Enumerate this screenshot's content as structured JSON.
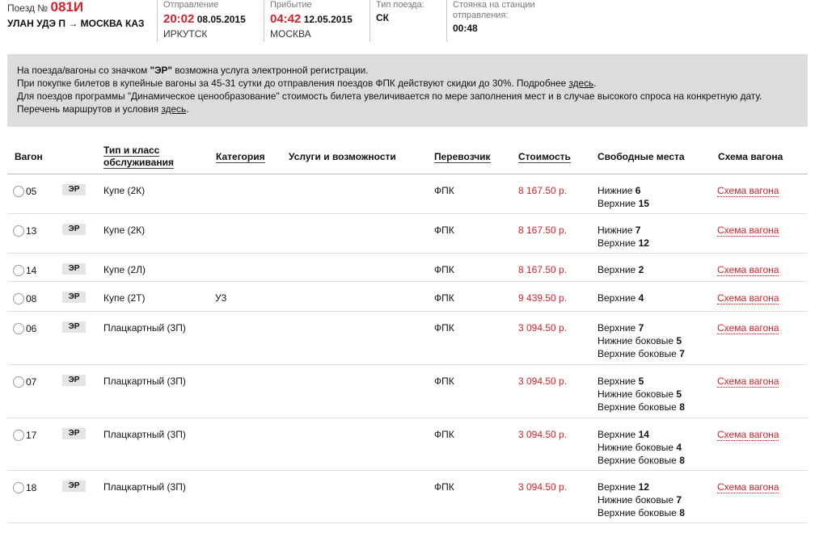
{
  "train": {
    "label": "Поезд №",
    "number": "081И",
    "route": "УЛАН УДЭ П → МОСКВА КАЗ"
  },
  "departure": {
    "label": "Отправление",
    "time": "20:02",
    "date": "08.05.2015",
    "city": "ИРКУТСК"
  },
  "arrival": {
    "label": "Прибытие",
    "time": "04:42",
    "date": "12.05.2015",
    "city": "МОСКВА"
  },
  "train_type": {
    "label": "Тип поезда:",
    "value": "СК"
  },
  "stop": {
    "label": "Стоянка на станции отправления:",
    "value": "00:48"
  },
  "info": {
    "line1_pre": "На поезда/вагоны со значком ",
    "line1_bold": "\"ЭР\"",
    "line1_post": " возможна услуга электронной регистрации.",
    "line2_pre": "При покупке билетов в купейные вагоны за 45-31 сутки до отправления поездов ФПК действуют скидки до 30%. Подробнее ",
    "line2_link": "здесь",
    "line2_post": ".",
    "line3": "Для поездов программы \"Динамическое ценообразование\" стоимость билета увеличивается по мере заполнения мест и в случае высокого спроса на конкретную дату.",
    "line4_pre": "Перечень маршрутов и условия ",
    "line4_link": "здесь",
    "line4_post": "."
  },
  "columns": {
    "car": "Вагон",
    "type_line1": "Тип и класс",
    "type_line2": "обслуживания",
    "category": "Категория",
    "services": "Услуги и возможности",
    "carrier": "Перевозчик",
    "price": "Стоимость",
    "seats": "Свободные места",
    "scheme": "Схема вагона"
  },
  "rows": [
    {
      "car": "05",
      "er": "ЭР",
      "type": "Купе (2К)",
      "category": "",
      "carrier": "ФПК",
      "price": "8 167.50 р.",
      "seats": [
        {
          "label": "Нижние",
          "count": "6"
        },
        {
          "label": "Верхние",
          "count": "15"
        }
      ],
      "scheme": "Схема вагона"
    },
    {
      "car": "13",
      "er": "ЭР",
      "type": "Купе (2К)",
      "category": "",
      "carrier": "ФПК",
      "price": "8 167.50 р.",
      "seats": [
        {
          "label": "Нижние",
          "count": "7"
        },
        {
          "label": "Верхние",
          "count": "12"
        }
      ],
      "scheme": "Схема вагона"
    },
    {
      "car": "14",
      "er": "ЭР",
      "type": "Купе (2Л)",
      "category": "",
      "carrier": "ФПК",
      "price": "8 167.50 р.",
      "seats": [
        {
          "label": "Верхние",
          "count": "2"
        }
      ],
      "scheme": "Схема вагона"
    },
    {
      "car": "08",
      "er": "ЭР",
      "type": "Купе (2Т)",
      "category": "У3",
      "carrier": "ФПК",
      "price": "9 439.50 р.",
      "seats": [
        {
          "label": "Верхние",
          "count": "4"
        }
      ],
      "scheme": "Схема вагона"
    },
    {
      "car": "06",
      "er": "ЭР",
      "type": "Плацкартный (3П)",
      "category": "",
      "carrier": "ФПК",
      "price": "3 094.50 р.",
      "seats": [
        {
          "label": "Верхние",
          "count": "7"
        },
        {
          "label": "Нижние боковые",
          "count": "5"
        },
        {
          "label": "Верхние боковые",
          "count": "7"
        }
      ],
      "scheme": "Схема вагона"
    },
    {
      "car": "07",
      "er": "ЭР",
      "type": "Плацкартный (3П)",
      "category": "",
      "carrier": "ФПК",
      "price": "3 094.50 р.",
      "seats": [
        {
          "label": "Верхние",
          "count": "5"
        },
        {
          "label": "Нижние боковые",
          "count": "5"
        },
        {
          "label": "Верхние боковые",
          "count": "8"
        }
      ],
      "scheme": "Схема вагона"
    },
    {
      "car": "17",
      "er": "ЭР",
      "type": "Плацкартный (3П)",
      "category": "",
      "carrier": "ФПК",
      "price": "3 094.50 р.",
      "seats": [
        {
          "label": "Верхние",
          "count": "14"
        },
        {
          "label": "Нижние боковые",
          "count": "4"
        },
        {
          "label": "Верхние боковые",
          "count": "8"
        }
      ],
      "scheme": "Схема вагона"
    },
    {
      "car": "18",
      "er": "ЭР",
      "type": "Плацкартный (3П)",
      "category": "",
      "carrier": "ФПК",
      "price": "3 094.50 р.",
      "seats": [
        {
          "label": "Верхние",
          "count": "12"
        },
        {
          "label": "Нижние боковые",
          "count": "7"
        },
        {
          "label": "Верхние боковые",
          "count": "8"
        }
      ],
      "scheme": "Схема вагона"
    }
  ]
}
